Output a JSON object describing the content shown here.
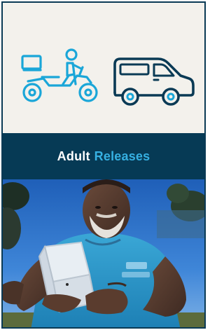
{
  "banner": {
    "word1": "Adult",
    "word2": "Releases"
  },
  "icons": [
    "delivery-motorbike-icon",
    "van-icon"
  ],
  "photo": {
    "subject": "man-holding-release-container"
  },
  "colors": {
    "border": "#0a3a55",
    "icon_panel_bg": "#f3f1ec",
    "motorbike_stroke": "#1aa6d8",
    "van_stroke": "#0a3a55",
    "van_wheel_accent": "#1aa6d8",
    "banner_bg": "#063a55",
    "banner_text_primary": "#ffffff",
    "banner_text_accent": "#36b0e2"
  }
}
